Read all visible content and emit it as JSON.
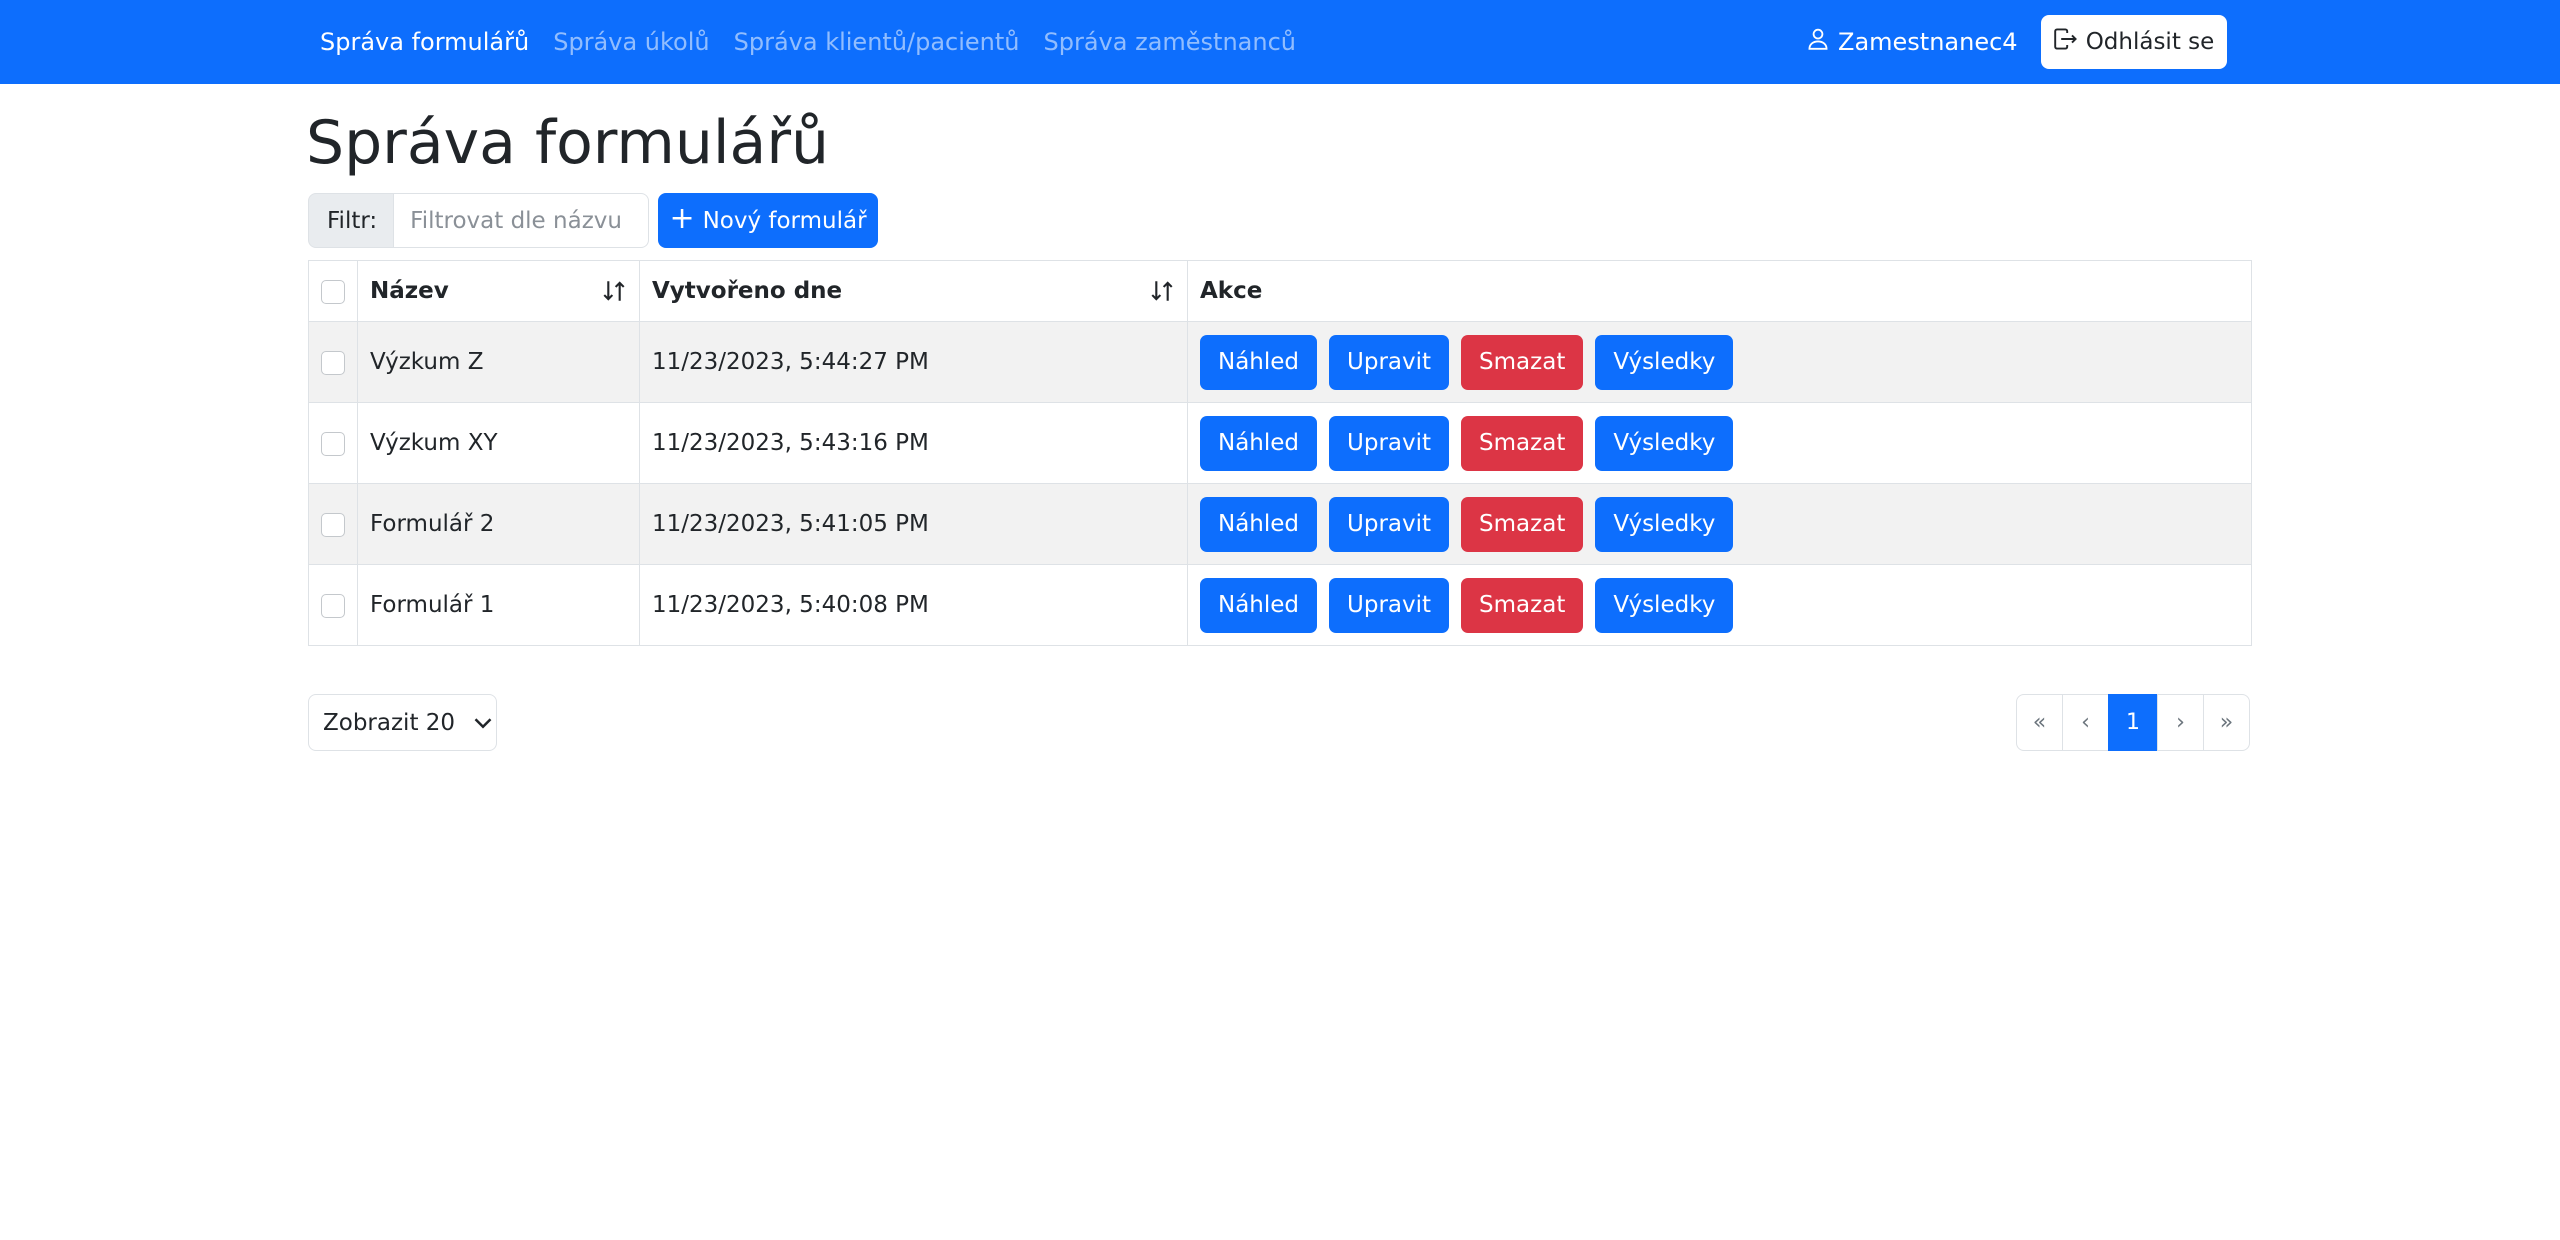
{
  "nav": {
    "links": [
      {
        "label": "Správa formulářů",
        "active": true
      },
      {
        "label": "Správa úkolů",
        "active": false
      },
      {
        "label": "Správa klientů/pacientů",
        "active": false
      },
      {
        "label": "Správa zaměstnanců",
        "active": false
      }
    ],
    "user": "Zamestnanec4",
    "logout_label": "Odhlásit se"
  },
  "page": {
    "title": "Správa formulářů"
  },
  "filter": {
    "label": "Filtr:",
    "placeholder": "Filtrovat dle názvu",
    "value": ""
  },
  "new_form_button": {
    "label": "Nový formulář"
  },
  "table": {
    "headers": {
      "name": "Název",
      "created": "Vytvořeno dne",
      "actions": "Akce"
    },
    "rows": [
      {
        "name": "Výzkum Z",
        "created": "11/23/2023, 5:44:27 PM"
      },
      {
        "name": "Výzkum XY",
        "created": "11/23/2023, 5:43:16 PM"
      },
      {
        "name": "Formulář 2",
        "created": "11/23/2023, 5:41:05 PM"
      },
      {
        "name": "Formulář 1",
        "created": "11/23/2023, 5:40:08 PM"
      }
    ],
    "action_labels": {
      "preview": "Náhled",
      "edit": "Upravit",
      "delete": "Smazat",
      "results": "Výsledky"
    }
  },
  "page_size": {
    "label": "Zobrazit 20"
  },
  "pagination": {
    "first": "«",
    "prev": "‹",
    "current": "1",
    "next": "›",
    "last": "»"
  },
  "colors": {
    "primary": "#0d6efd",
    "danger": "#dc3545",
    "striped_row": "#f2f2f2"
  }
}
